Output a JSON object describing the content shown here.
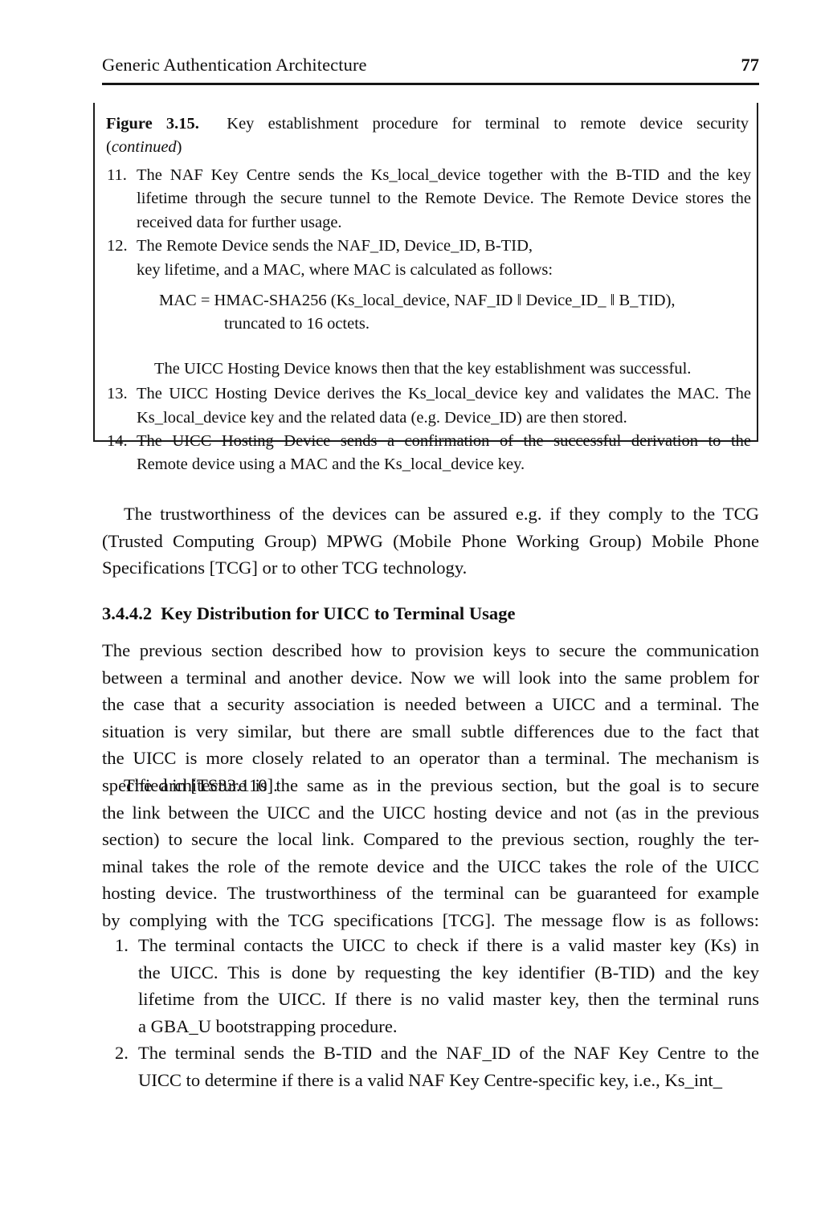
{
  "running_head": {
    "title": "Generic Authentication Architecture",
    "page_number": "77"
  },
  "figure_box": {
    "caption": {
      "label": "Figure 3.15.",
      "text": "Key establishment procedure for terminal to remote device security",
      "continued": "(continued)",
      "continued_open": "(",
      "continued_word": "continued",
      "continued_close": ")"
    },
    "items": [
      {
        "number": "11.",
        "lines": [
          "The NAF Key Centre sends the Ks_local_device together with the B-TID and the key",
          "lifetime through the secure tunnel to the Remote Device. The Remote Device stores the",
          "received data for further usage."
        ]
      },
      {
        "number": "12.",
        "lines": [
          "The Remote Device sends the NAF_ID, Device_ID, B-TID,",
          "key lifetime, and a MAC, where MAC is calculated as follows:"
        ]
      }
    ],
    "formula": {
      "line1": "MAC = HMAC-SHA256 (Ks_local_device, NAF_ID ‖ Device_ID_ ‖ B_TID),",
      "line2": "truncated to 16 octets."
    },
    "note": "The UICC Hosting Device knows then that the key establishment was successful.",
    "items_after": [
      {
        "number": "13.",
        "lines": [
          "The UICC Hosting Device derives the Ks_local_device key and validates the MAC. The",
          "Ks_local_device key and the related data (e.g. Device_ID) are then stored."
        ]
      },
      {
        "number": "14.",
        "lines": [
          "The UICC Hosting Device sends a confirmation of the successful derivation to the",
          "Remote device using a MAC and the Ks_local_device key."
        ]
      }
    ]
  },
  "paragraph_tcg": {
    "lines": [
      "The trustworthiness of the devices can be assured e.g. if they comply to the TCG",
      "(Trusted Computing Group) MPWG (Mobile Phone Working Group) Mobile Phone",
      "Specifications [TCG] or to other TCG technology."
    ]
  },
  "section": {
    "number": "3.4.4.2",
    "title": "Key Distribution for UICC to Terminal Usage"
  },
  "paragraph_previous": {
    "lines": [
      "The previous section described how to provision keys to secure the communication",
      "between a terminal and another device. Now we will look into the same problem for",
      "the case that a security association is needed between a UICC and a terminal. The",
      "situation is very similar, but there are small subtle differences due to the fact that",
      "the UICC is more closely related to an operator than a terminal. The mechanism is",
      "specified in [TS33.110]."
    ]
  },
  "paragraph_architecture": {
    "lines": [
      "The architecture is the same as in the previous section, but the goal is to secure",
      "the link between the UICC and the UICC hosting device and not (as in the previous",
      "section) to secure the local link. Compared to the previous section, roughly the ter-",
      "minal takes the role of the remote device and the UICC takes the role of the UICC",
      "hosting device. The trustworthiness of the terminal can be guaranteed for example",
      "by complying with the TCG specifications [TCG]. The message flow is as follows:"
    ]
  },
  "body_list": [
    {
      "number": "1.",
      "lines": [
        "The terminal contacts the UICC to check if there is a valid master key (Ks) in",
        "the UICC. This is done by requesting the key identifier (B-TID) and the key",
        "lifetime from the UICC. If there is no valid master key, then the terminal runs",
        "a GBA_U bootstrapping procedure."
      ]
    },
    {
      "number": "2.",
      "lines": [
        "The terminal sends the B-TID and the NAF_ID of the NAF Key Centre to the",
        "UICC to determine if there is a valid NAF Key Centre-specific key, i.e., Ks_int_"
      ]
    }
  ]
}
